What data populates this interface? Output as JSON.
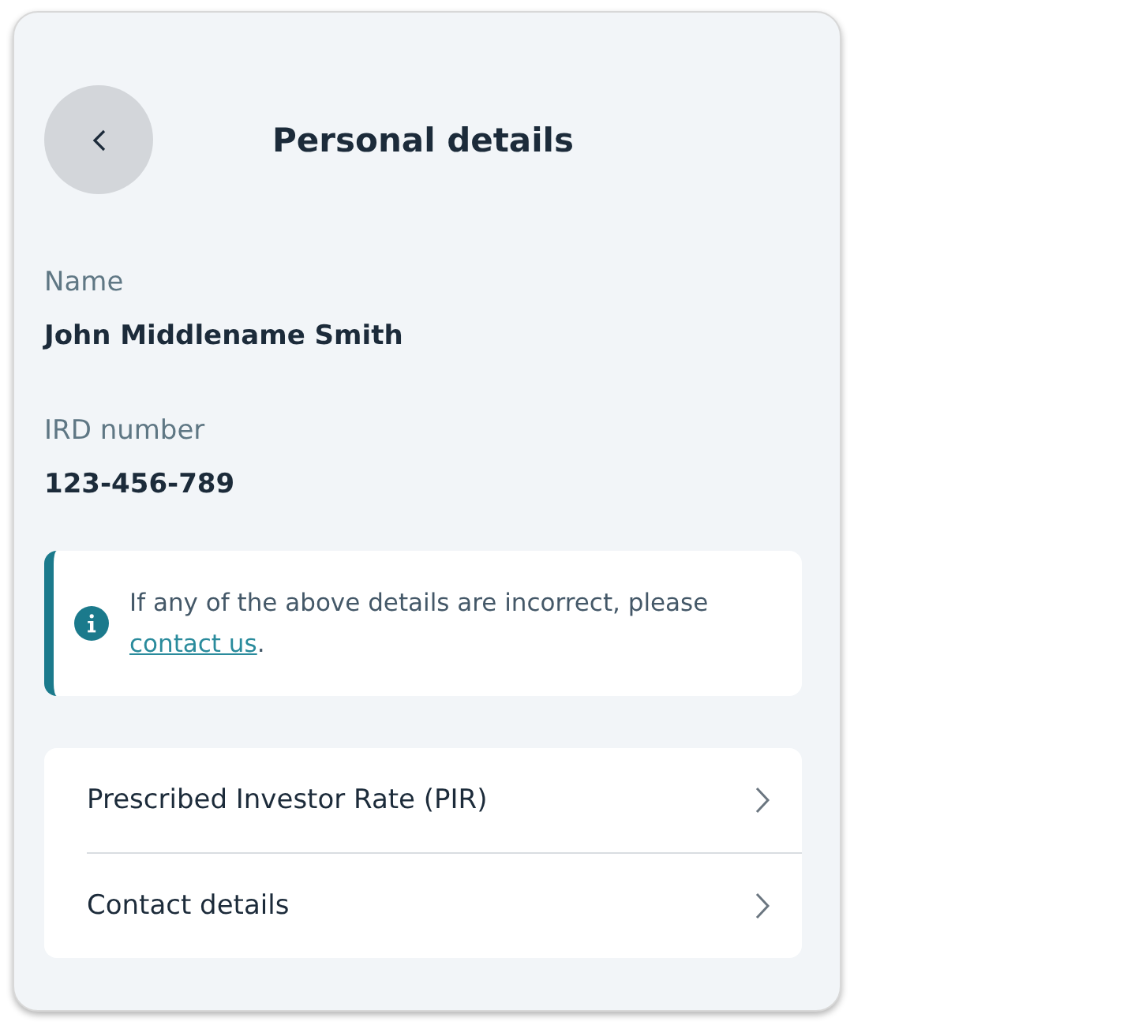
{
  "header": {
    "title": "Personal details"
  },
  "fields": [
    {
      "label": "Name",
      "value": "John Middlename Smith"
    },
    {
      "label": "IRD number",
      "value": "123-456-789"
    }
  ],
  "notice": {
    "text": "If any of the above details are incorrect, please ",
    "link": "contact us",
    "after": "."
  },
  "menu": [
    {
      "label": "Prescribed Investor Rate (PIR)"
    },
    {
      "label": "Contact details"
    }
  ]
}
